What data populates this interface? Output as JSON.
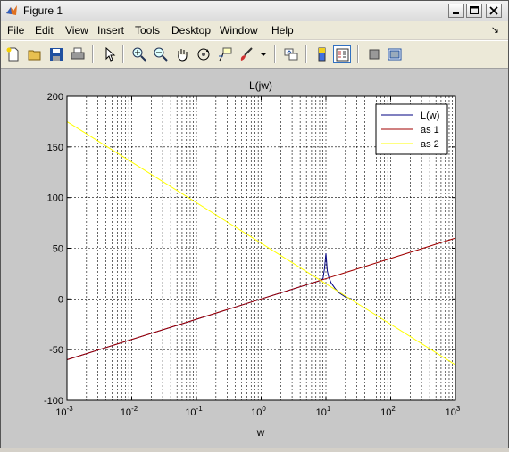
{
  "window": {
    "title": "Figure 1"
  },
  "menu": {
    "items": [
      "File",
      "Edit",
      "View",
      "Insert",
      "Tools",
      "Desktop",
      "Window",
      "Help"
    ]
  },
  "toolbar": {
    "icons": [
      "new-figure-icon",
      "open-icon",
      "save-icon",
      "print-icon",
      "pointer-icon",
      "zoom-in-icon",
      "zoom-out-icon",
      "pan-icon",
      "rotate-icon",
      "data-cursor-icon",
      "brush-icon",
      "link-icon",
      "colorbar-icon",
      "legend-icon",
      "hide-plot-tools-icon",
      "show-plot-tools-icon"
    ]
  },
  "chart_data": {
    "type": "line",
    "title": "L(jw)",
    "xlabel": "w",
    "ylabel": "",
    "xscale": "log",
    "xlim": [
      0.001,
      1000
    ],
    "ylim": [
      -100,
      200
    ],
    "xticks": [
      "10^-3",
      "10^-2",
      "10^-1",
      "10^0",
      "10^1",
      "10^2",
      "10^3"
    ],
    "yticks": [
      "200",
      "150",
      "100",
      "50",
      "0",
      "-50",
      "-100"
    ],
    "grid": true,
    "legend_position": "top-right",
    "series": [
      {
        "name": "L(w)",
        "color": "#000080",
        "x": [
          0.001,
          0.01,
          0.1,
          1,
          3,
          6,
          8,
          9,
          9.5,
          10,
          10.5,
          11,
          12,
          14,
          16,
          20,
          25
        ],
        "y": [
          -60,
          -40,
          -20,
          0,
          9.5,
          15.5,
          18,
          20,
          30,
          45,
          28,
          22,
          16,
          10,
          6,
          2,
          0
        ]
      },
      {
        "name": "as 1",
        "color": "#a00000",
        "x": [
          0.001,
          1000
        ],
        "y": [
          -60,
          60
        ]
      },
      {
        "name": "as 2",
        "color": "#ffff00",
        "x": [
          0.001,
          10,
          1000
        ],
        "y": [
          175,
          15,
          -65
        ]
      }
    ]
  }
}
